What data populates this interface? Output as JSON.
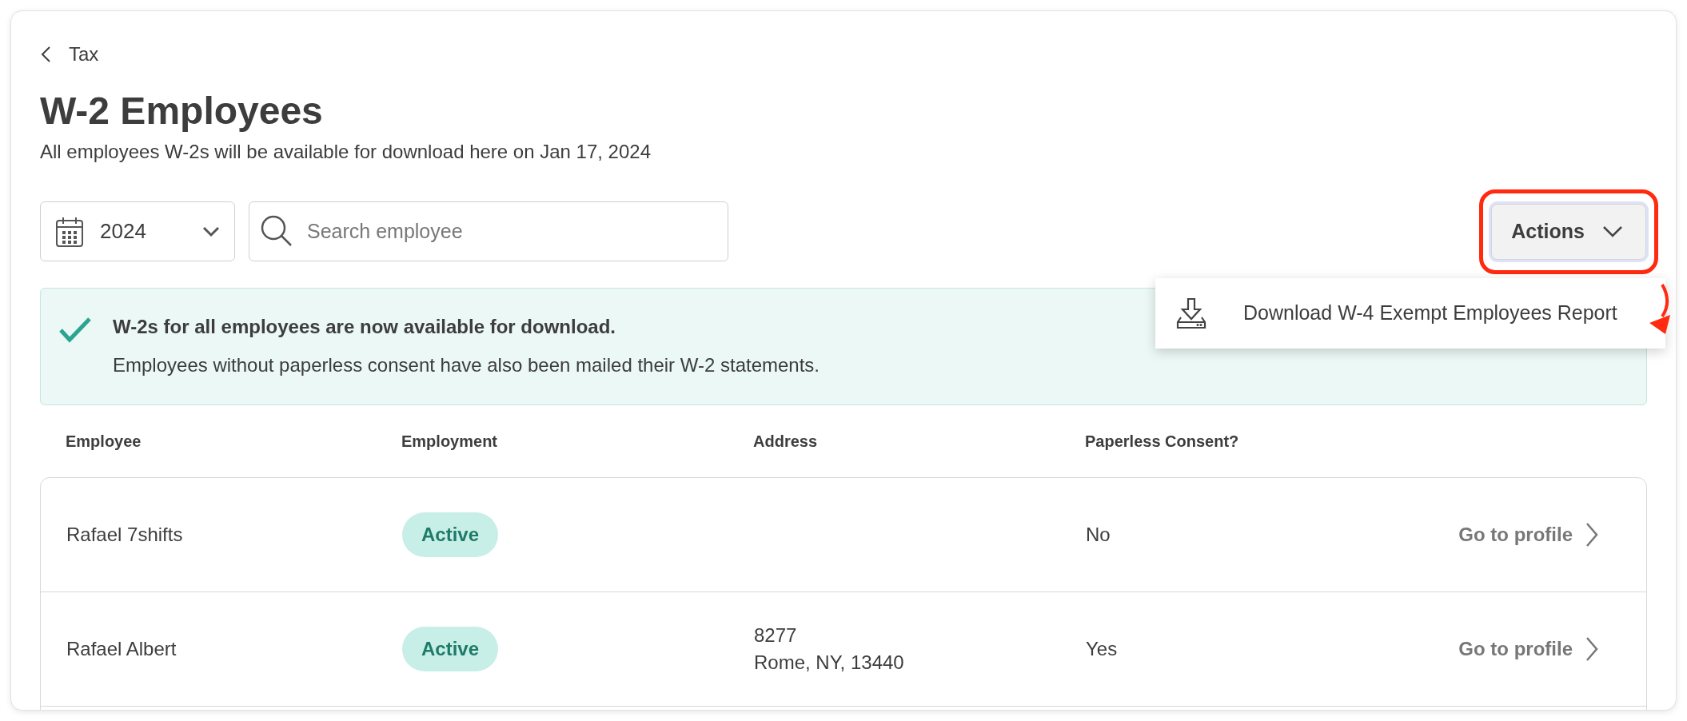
{
  "back_link": {
    "label": "Tax"
  },
  "title": "W-2 Employees",
  "subtitle": "All employees W-2s will be available for download here on Jan 17, 2024",
  "year_select": {
    "value": "2024"
  },
  "search": {
    "placeholder": "Search employee"
  },
  "actions": {
    "label": "Actions",
    "expanded": true,
    "highlighted": true,
    "menu": [
      {
        "label": "Download W-4 Exempt Employees Report"
      }
    ]
  },
  "banner": {
    "title": "W-2s for all employees are now available for download.",
    "message": "Employees without paperless consent have also been mailed their W-2 statements."
  },
  "table": {
    "columns": [
      "Employee",
      "Employment",
      "Address",
      "Paperless Consent?"
    ],
    "rows": [
      {
        "employee": "Rafael 7shifts",
        "employment": "Active",
        "address": [],
        "paperless": "No",
        "link": "Go to profile"
      },
      {
        "employee": "Rafael Albert",
        "employment": "Active",
        "address": [
          "8277",
          "Rome, NY, 13440"
        ],
        "paperless": "Yes",
        "link": "Go to profile"
      }
    ]
  }
}
